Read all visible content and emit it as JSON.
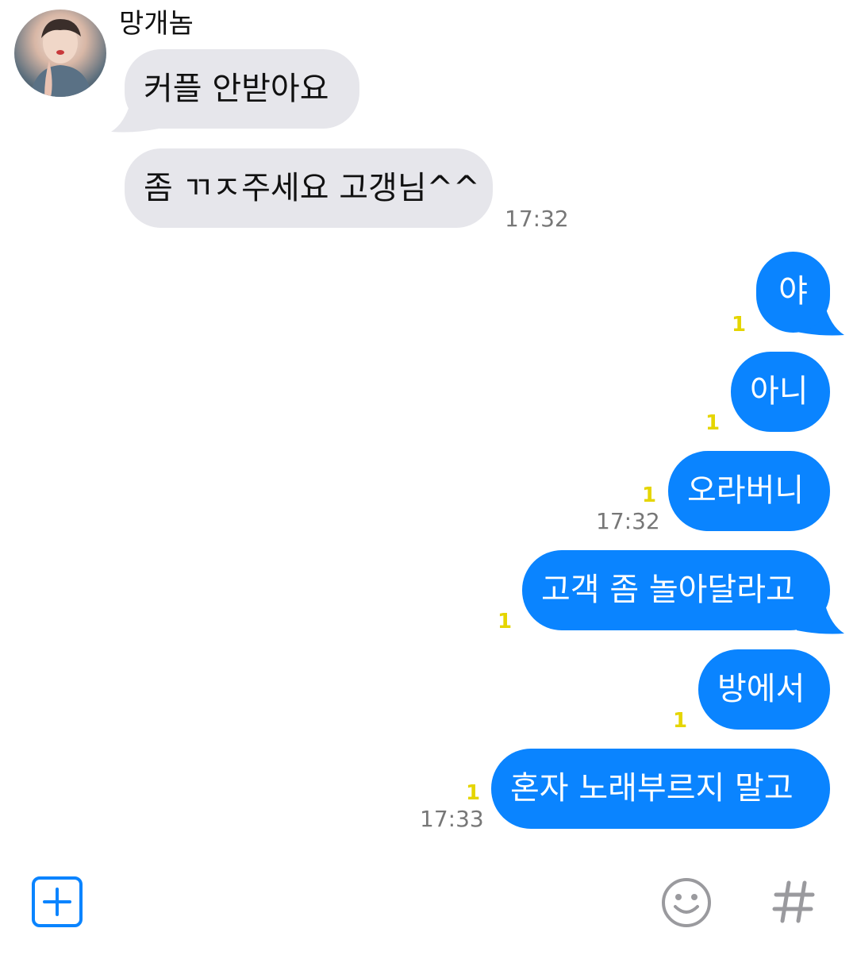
{
  "chat": {
    "sender_name": "망개놈",
    "messages": [
      {
        "text": "커플 안받아요",
        "direction": "in"
      },
      {
        "text": "좀 ㄲㅈ주세요 고갱님^^",
        "direction": "in",
        "time": "17:32"
      },
      {
        "text": "야",
        "direction": "out",
        "unread": "1"
      },
      {
        "text": "아니",
        "direction": "out",
        "unread": "1"
      },
      {
        "text": "오라버니",
        "direction": "out",
        "unread": "1",
        "time": "17:32"
      },
      {
        "text": "고객 좀 놀아달라고",
        "direction": "out",
        "unread": "1"
      },
      {
        "text": "방에서",
        "direction": "out",
        "unread": "1"
      },
      {
        "text": "혼자 노래부르지 말고",
        "direction": "out",
        "unread": "1",
        "time": "17:33"
      }
    ]
  },
  "input_bar": {
    "add_icon": "plus-square-icon",
    "emoji_icon": "smiley-icon",
    "hash_icon": "hash-icon"
  },
  "colors": {
    "outgoing_bubble": "#0a84ff",
    "incoming_bubble": "#e6e6eb",
    "unread_badge": "#e5d500",
    "timestamp": "#777777"
  }
}
